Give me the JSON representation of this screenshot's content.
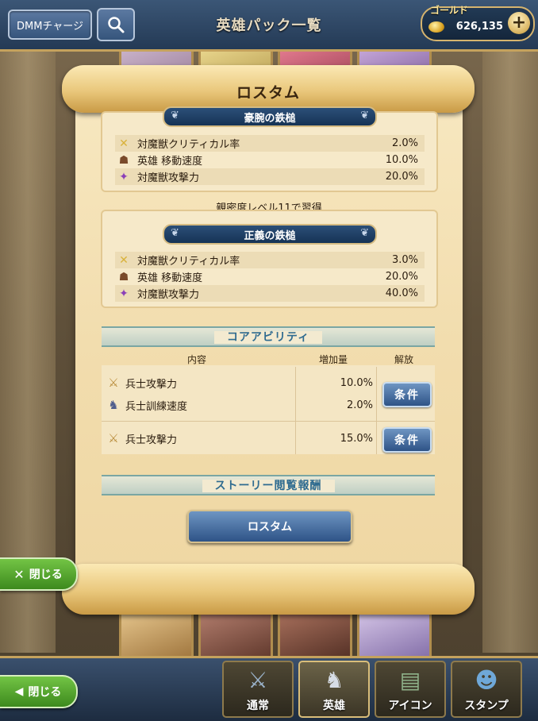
{
  "top_bar": {
    "dmm_button": "DMMチャージ",
    "title": "英雄パック一覧",
    "gold_label": "ゴールド",
    "gold_value": "626,135",
    "plus_label": "+"
  },
  "scroll": {
    "title": "ロスタム"
  },
  "equipment_1": {
    "name": "豪腕の鉄槌",
    "stats": [
      {
        "icon": "sword-cross-icon",
        "label": "対魔獣クリティカル率",
        "value": "2.0%"
      },
      {
        "icon": "hero-icon",
        "label": "英雄 移動速度",
        "value": "10.0%"
      },
      {
        "icon": "power-icon",
        "label": "対魔獣攻撃力",
        "value": "20.0%"
      }
    ]
  },
  "learn_text": "親密度レベル11で習得",
  "equipment_2": {
    "name": "正義の鉄槌",
    "stats": [
      {
        "icon": "sword-cross-icon",
        "label": "対魔獣クリティカル率",
        "value": "3.0%"
      },
      {
        "icon": "hero-icon",
        "label": "英雄 移動速度",
        "value": "20.0%"
      },
      {
        "icon": "power-icon",
        "label": "対魔獣攻撃力",
        "value": "40.0%"
      }
    ]
  },
  "core_ability": {
    "title": "コアアビリティ",
    "col_content": "内容",
    "col_increase": "増加量",
    "col_unlock": "解放",
    "rows": [
      {
        "icon": "sword-icon",
        "label": "兵士攻撃力",
        "value": "10.0%"
      },
      {
        "icon": "soldier-icon",
        "label": "兵士訓練速度",
        "value": "2.0%"
      },
      {
        "icon": "sword-icon",
        "label": "兵士攻撃力",
        "value": "15.0%"
      }
    ],
    "condition_button": "条件"
  },
  "story": {
    "title": "ストーリー閲覧報酬",
    "button": "ロスタム"
  },
  "close_buttons": {
    "x_close": "閉じる",
    "back_close": "閉じる"
  },
  "bottom_tabs": [
    {
      "label": "通常"
    },
    {
      "label": "英雄"
    },
    {
      "label": "アイコン"
    },
    {
      "label": "スタンプ"
    }
  ]
}
